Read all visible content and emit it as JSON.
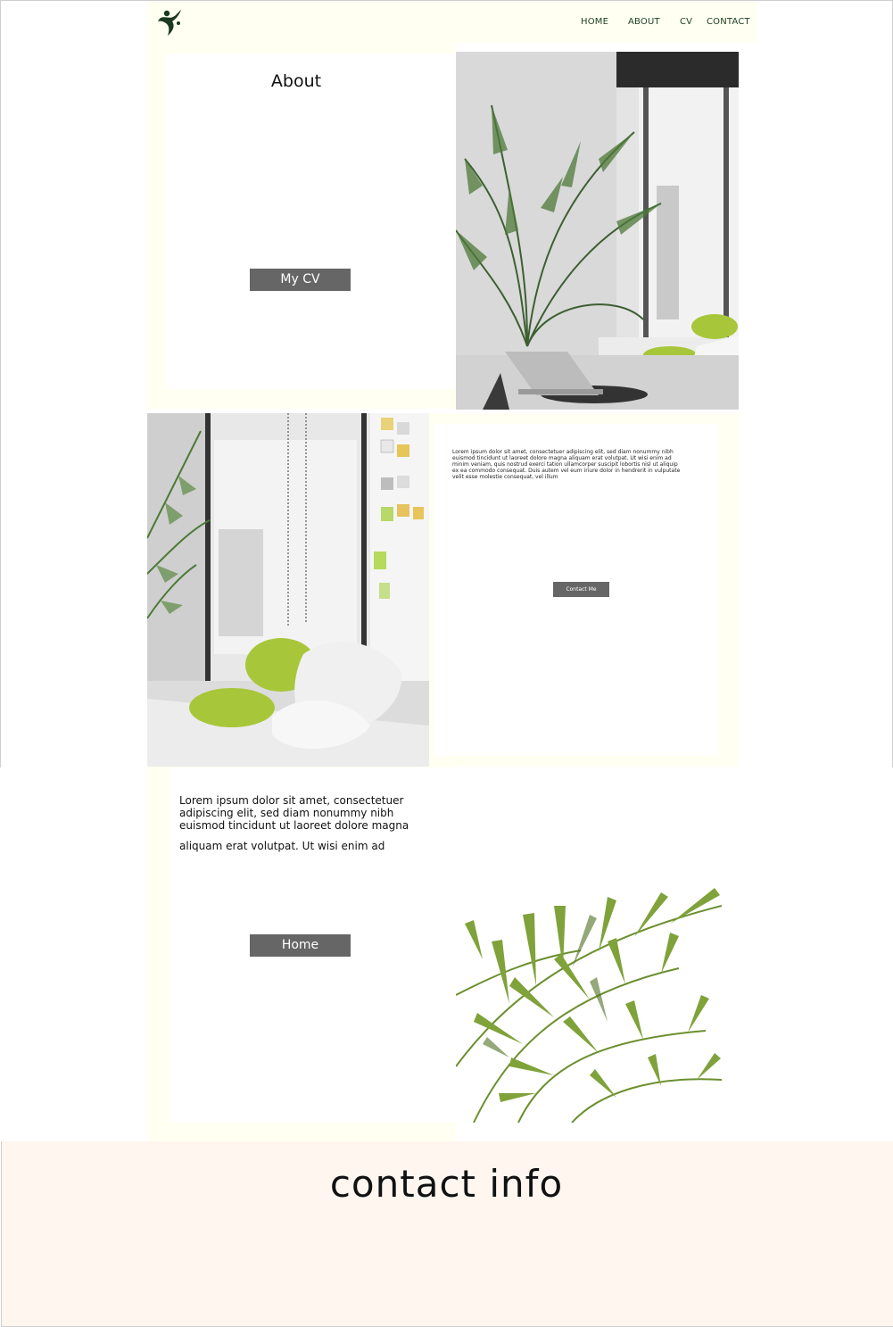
{
  "nav": {
    "home": "HOME",
    "about": "ABOUT",
    "cv": "CV",
    "contact": "CONTACT"
  },
  "about": {
    "title": "About",
    "cv_button": "My CV"
  },
  "intro": {
    "text": "Lorem ipsum dolor sit amet, consectetuer adipiscing elit, sed diam nonummy nibh euismod tincidunt ut laoreet dolore magna aliquam erat volutpat. Ut wisi enim ad minim veniam, quis nostrud exerci tation ullamcorper suscipit lobortis nisl ut aliquip ex ea commodo consequat. Duis autem vel eum iriure dolor in hendrerit in vulputate velit esse molestie consequat, vel illum",
    "contact_button": "Contact Me"
  },
  "bottom": {
    "text_1": "Lorem ipsum dolor sit amet, consectetuer adipiscing elit, sed diam nonummy nibh euismod tincidunt ut laoreet dolore magna",
    "text_2": "aliquam erat volutpat. Ut wisi enim ad",
    "home_button": "Home"
  },
  "footer": {
    "title": "contact info"
  },
  "colors": {
    "cream": "#fffff2",
    "button": "#666666",
    "nav_text": "#1f4226",
    "footer_bg": "#fff6ef",
    "accent_green": "#a8c63a"
  },
  "icons": {
    "logo": "leaping-figure-logo"
  }
}
